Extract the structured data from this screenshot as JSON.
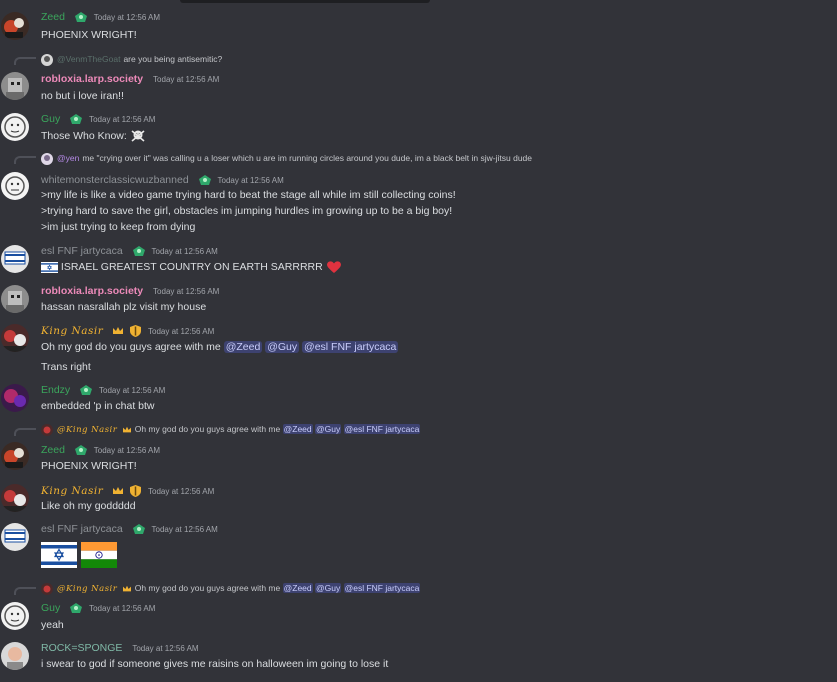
{
  "messages": [
    {
      "user": "Zeed",
      "time": "Today at 12:56 AM",
      "text": "PHOENIX WRIGHT!"
    },
    {
      "reply_user": "@VenmTheGoat",
      "reply_text": "are you being antisemitic?",
      "user": "robloxia.larp.society",
      "time": "Today at 12:56 AM",
      "text": "no but i love iran!!"
    },
    {
      "user": "Guy",
      "time": "Today at 12:56 AM",
      "text": "Those Who Know:"
    },
    {
      "reply_user": "@yen",
      "reply_text": "me \"crying over it\" was calling u a loser which u are im running circles around you dude, im a black belt in sjw-jitsu dude",
      "user": "whitemonsterclassicwuzbanned",
      "time": "Today at 12:56 AM",
      "lines": [
        ">my life is like a video game trying hard to beat the stage all while im still collecting coins!",
        ">trying hard to save the girl, obstacles im jumping hurdles im growing up to be a big boy!",
        ">im just trying to keep from dying"
      ]
    },
    {
      "user": "esl FNF jartycaca",
      "time": "Today at 12:56 AM",
      "text": "ISRAEL GREATEST COUNTRY ON EARTH SARRRRR"
    },
    {
      "user": "robloxia.larp.society",
      "time": "Today at 12:56 AM",
      "text": "hassan nasrallah plz visit my house"
    },
    {
      "user": "King Nasir",
      "time": "Today at 12:56 AM",
      "text": "Oh my god do you guys agree with me",
      "mentions": [
        "@Zeed",
        "@Guy",
        "@esl FNF jartycaca"
      ],
      "text2": "Trans right"
    },
    {
      "user": "Endzy",
      "time": "Today at 12:56 AM",
      "text": "embedded 'p in chat btw"
    },
    {
      "reply_user": "@King Nasir",
      "reply_text": "Oh my god do you guys agree with me",
      "reply_mentions": [
        "@Zeed",
        "@Guy",
        "@esl FNF jartycaca"
      ],
      "user": "Zeed",
      "time": "Today at 12:56 AM",
      "text": "PHOENIX WRIGHT!"
    },
    {
      "user": "King Nasir",
      "time": "Today at 12:56 AM",
      "text": "Like oh my goddddd"
    },
    {
      "user": "esl FNF jartycaca",
      "time": "Today at 12:56 AM",
      "text": ""
    },
    {
      "reply_user": "@King Nasir",
      "reply_text": "Oh my god do you guys agree with me",
      "reply_mentions": [
        "@Zeed",
        "@Guy",
        "@esl FNF jartycaca"
      ],
      "user": "Guy",
      "time": "Today at 12:56 AM",
      "text": "yeah"
    },
    {
      "user": "ROCK=SPONGE",
      "time": "Today at 12:56 AM",
      "text": "i swear to god if someone gives me raisins on halloween im going to lose it"
    }
  ],
  "colors": {
    "background": "#323339",
    "mention_bg": "#3d4270",
    "mention_fg": "#c9cdfb",
    "gold_name": "#f0b232",
    "green_name": "#3ba55c",
    "pink_name": "#ec8ab9",
    "gray_name": "#8e9297"
  },
  "icons": [
    "skull-crossbones-icon",
    "heart-icon",
    "israel-flag-icon",
    "india-flag-icon",
    "crown-icon",
    "shield-icon",
    "nitro-badge-icon"
  ]
}
